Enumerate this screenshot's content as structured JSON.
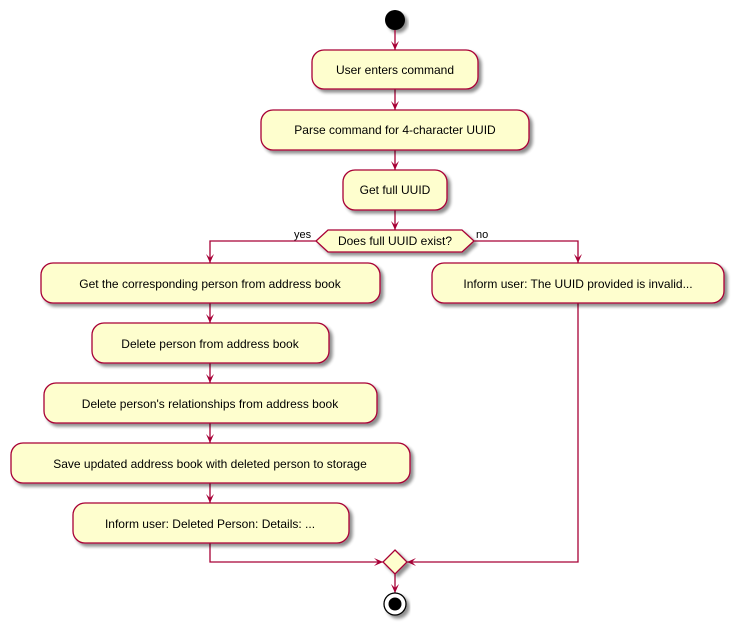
{
  "diagram": {
    "type": "activity",
    "colors": {
      "node_fill": "#FEFECE",
      "border": "#A80036",
      "shadow": "#B0B0B0",
      "start_end": "#000000"
    },
    "actions": {
      "user_enters": "User enters command",
      "parse": "Parse command for 4-character UUID",
      "get_full": "Get full UUID",
      "get_person": "Get the corresponding person from address book",
      "delete_person": "Delete person from address book",
      "delete_relationships": "Delete person's relationships from address book",
      "save": "Save updated address book with deleted person to storage",
      "inform_deleted": "Inform user: Deleted Person: Details: ...",
      "inform_invalid": "Inform user: The UUID provided is invalid..."
    },
    "decision": {
      "question": "Does full UUID exist?",
      "yes_label": "yes",
      "no_label": "no"
    }
  }
}
